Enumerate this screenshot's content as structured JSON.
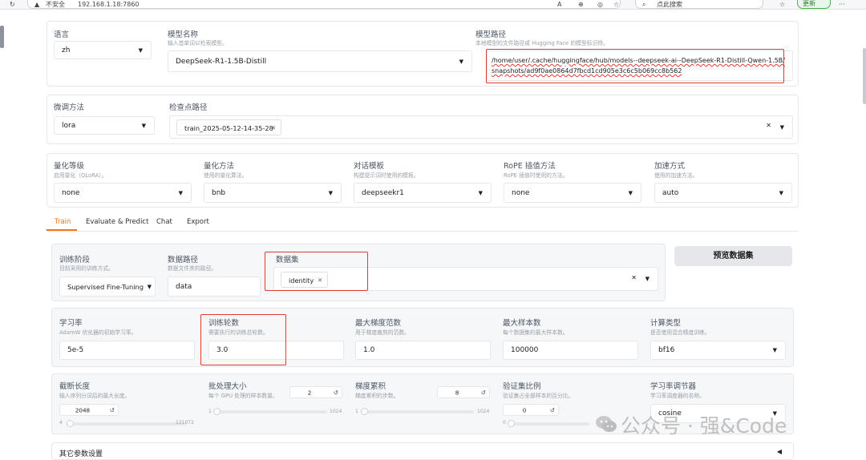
{
  "browser": {
    "security_label": "不安全",
    "url": "192.168.1.18:7860",
    "search_placeholder": "点此搜索",
    "update_label": "更新",
    "more": "···"
  },
  "top_panel": {
    "language_label": "语言",
    "language_value": "zh",
    "model_name_label": "模型名称",
    "model_name_desc": "输入首单词以检索模型。",
    "model_name_value": "DeepSeek-R1-1.5B-Distill",
    "model_path_label": "模型路径",
    "model_path_desc": "本地模型的文件路径或 Hugging Face 的模型标识符。",
    "model_path_value": "/home/user/.cache/huggingface/hub/models--deepseek-ai--DeepSeek-R1-Distill-Qwen-1.5B/snapshots/ad9f0ae0864d7fbcd1cd905e3c6c5b069cc8b562"
  },
  "finetune_panel": {
    "method_label": "微调方法",
    "method_value": "lora",
    "checkpoint_label": "检查点路径",
    "checkpoint_chip": "train_2025-05-12-14-35-28"
  },
  "quant_panel": {
    "quant_level_label": "量化等级",
    "quant_level_desc": "启用量化（QLoRA）。",
    "quant_level_value": "none",
    "quant_method_label": "量化方法",
    "quant_method_desc": "使用的量化算法。",
    "quant_method_value": "bnb",
    "template_label": "对话模板",
    "template_desc": "构建提示词时使用的模板。",
    "template_value": "deepseekr1",
    "rope_label": "RoPE 插值方法",
    "rope_desc": "RoPE 插值时使用的方法。",
    "rope_value": "none",
    "accel_label": "加速方式",
    "accel_desc": "使用的加速方法。",
    "accel_value": "auto"
  },
  "tabs": [
    {
      "label": "Train",
      "active": true
    },
    {
      "label": "Evaluate & Predict",
      "active": false
    },
    {
      "label": "Chat",
      "active": false
    },
    {
      "label": "Export",
      "active": false
    }
  ],
  "train": {
    "stage_label": "训练阶段",
    "stage_desc": "目前采用的训练方式。",
    "stage_value": "Supervised Fine-Tuning",
    "dataset_dir_label": "数据路径",
    "dataset_dir_desc": "数据文件夹的路径。",
    "dataset_dir_value": "data",
    "dataset_label": "数据集",
    "dataset_chip": "identity",
    "preview_button": "预览数据集",
    "lr_label": "学习率",
    "lr_desc": "AdamW 优化器的初始学习率。",
    "lr_value": "5e-5",
    "epochs_label": "训练轮数",
    "epochs_desc": "需要执行的训练总轮数。",
    "epochs_value": "3.0",
    "max_grad_label": "最大梯度范数",
    "max_grad_desc": "用于梯度裁剪的范数。",
    "max_grad_value": "1.0",
    "max_samples_label": "最大样本数",
    "max_samples_desc": "每个数据集的最大样本数。",
    "max_samples_value": "100000",
    "compute_label": "计算类型",
    "compute_desc": "是否使用混合精度训练。",
    "compute_value": "bf16",
    "cutoff_label": "截断长度",
    "cutoff_desc": "输入序列分词后的最大长度。",
    "cutoff_value": "2048",
    "cutoff_min": "4",
    "cutoff_max": "131072",
    "cutoff_fraction": 0.015,
    "batch_label": "批处理大小",
    "batch_desc": "每个 GPU 处理的样本数量。",
    "batch_value": "2",
    "batch_min": "1",
    "batch_max": "1024",
    "batch_fraction": 0.001,
    "grad_acc_label": "梯度累积",
    "grad_acc_desc": "梯度累积的步数。",
    "grad_acc_value": "8",
    "grad_acc_min": "1",
    "grad_acc_max": "1024",
    "grad_acc_fraction": 0.007,
    "val_label": "验证集比例",
    "val_desc": "验证集占全部样本的百分比。",
    "val_value": "0",
    "val_min": "0",
    "val_fraction": 0.0,
    "scheduler_label": "学习率调节器",
    "scheduler_desc": "学习率调度器的名称。",
    "scheduler_value": "cosine"
  },
  "other": {
    "label": "其它参数设置"
  },
  "watermark": {
    "text": "公众号 · 强&Code"
  },
  "colors": {
    "accent": "#f97316",
    "highlight": "#e53935"
  }
}
